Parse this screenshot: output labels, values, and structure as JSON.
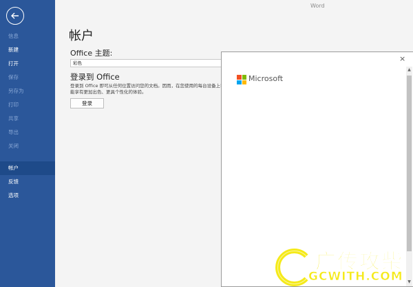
{
  "app_title": "Word",
  "sidebar": {
    "items": [
      {
        "label": "信息"
      },
      {
        "label": "新建"
      },
      {
        "label": "打开"
      },
      {
        "label": "保存"
      },
      {
        "label": "另存为"
      },
      {
        "label": "打印"
      },
      {
        "label": "共享"
      },
      {
        "label": "导出"
      },
      {
        "label": "关闭"
      },
      {
        "label": "帐户"
      },
      {
        "label": "反馈"
      },
      {
        "label": "选项"
      }
    ]
  },
  "account": {
    "title": "帐户",
    "theme_label": "Office 主题:",
    "theme_value": "彩色",
    "signin_title": "登录到 Office",
    "signin_desc": "登录到 Office 即可从任何位置访问您的文档。因而，在您使用的每台设备上都能享有更加出色、更具个性化的体验。",
    "signin_button": "登录"
  },
  "dialog": {
    "close_glyph": "×",
    "brand": "Microsoft",
    "logo_colors": [
      "#f25022",
      "#7fba00",
      "#00a4ef",
      "#ffb900"
    ]
  },
  "watermark": {
    "text": "广传攻柴",
    "url": "GCWITH.COM",
    "color": "#f5ea1a"
  }
}
